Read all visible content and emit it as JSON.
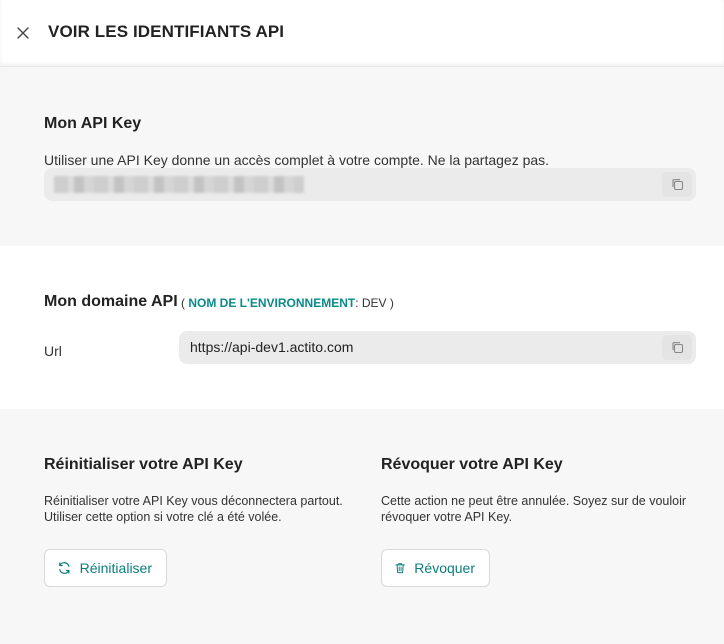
{
  "header": {
    "title": "VOIR LES IDENTIFIANTS API",
    "close_icon": "close-icon"
  },
  "api_key": {
    "title": "Mon API Key",
    "description": "Utiliser une API Key donne un accès complet à votre compte. Ne la partagez pas.",
    "copy_icon": "copy-icon"
  },
  "domain": {
    "title": "Mon domaine API",
    "env_open": "(",
    "env_label": "NOM DE L'ENVIRONNEMENT",
    "env_sep": ":",
    "env_value": "DEV",
    "env_close": ")",
    "url_label": "Url",
    "url_value": "https://api-dev1.actito.com",
    "copy_icon": "copy-icon"
  },
  "reset": {
    "title": "Réinitialiser votre API Key",
    "line1": "Réinitialiser votre API Key vous déconnectera partout.",
    "line2": "Utiliser cette option si votre clé a été volée.",
    "button_label": "Réinitialiser",
    "icon": "refresh-icon"
  },
  "revoke": {
    "title": "Révoquer votre API Key",
    "line1": "Cette action ne peut être annulée. Soyez sur de vouloir",
    "line2": "révoquer votre API Key.",
    "button_label": "Révoquer",
    "icon": "trash-icon"
  },
  "colors": {
    "accent": "#0b8a8a",
    "button_text": "#0b7d7d",
    "section_bg": "#f7f7f7",
    "field_bg": "#ebebeb"
  }
}
